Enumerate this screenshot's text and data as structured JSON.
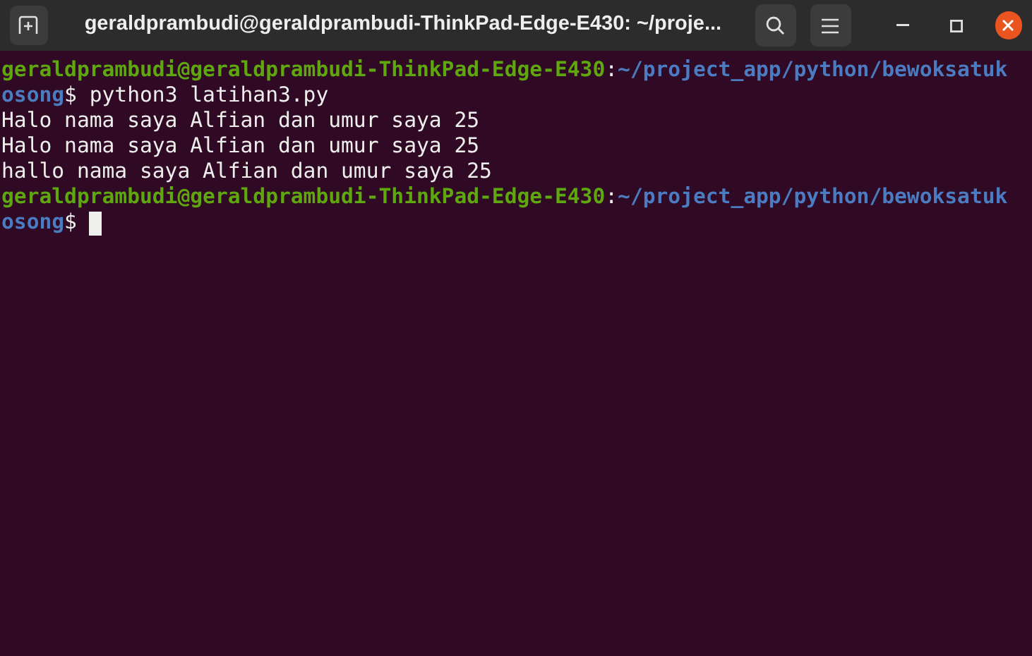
{
  "window": {
    "title": "geraldprambudi@geraldprambudi-ThinkPad-Edge-E430: ~/proje..."
  },
  "terminal": {
    "lines": [
      {
        "cursor": false,
        "segments": [
          {
            "kind": "user",
            "text": "geraldprambudi@geraldprambudi-ThinkPad-Edge-E430"
          },
          {
            "kind": "plain",
            "text": ":"
          },
          {
            "kind": "path",
            "text": "~/project_app/python/bewoksatuk"
          }
        ]
      },
      {
        "cursor": false,
        "segments": [
          {
            "kind": "path",
            "text": "osong"
          },
          {
            "kind": "plain",
            "text": "$ python3 latihan3.py"
          }
        ]
      },
      {
        "cursor": false,
        "segments": [
          {
            "kind": "plain",
            "text": "Halo nama saya Alfian dan umur saya 25"
          }
        ]
      },
      {
        "cursor": false,
        "segments": [
          {
            "kind": "plain",
            "text": "Halo nama saya Alfian dan umur saya 25"
          }
        ]
      },
      {
        "cursor": false,
        "segments": [
          {
            "kind": "plain",
            "text": "hallo nama saya Alfian dan umur saya 25"
          }
        ]
      },
      {
        "cursor": false,
        "segments": [
          {
            "kind": "user",
            "text": "geraldprambudi@geraldprambudi-ThinkPad-Edge-E430"
          },
          {
            "kind": "plain",
            "text": ":"
          },
          {
            "kind": "path",
            "text": "~/project_app/python/bewoksatuk"
          }
        ]
      },
      {
        "cursor": true,
        "segments": [
          {
            "kind": "path",
            "text": "osong"
          },
          {
            "kind": "plain",
            "text": "$ "
          }
        ]
      }
    ]
  }
}
